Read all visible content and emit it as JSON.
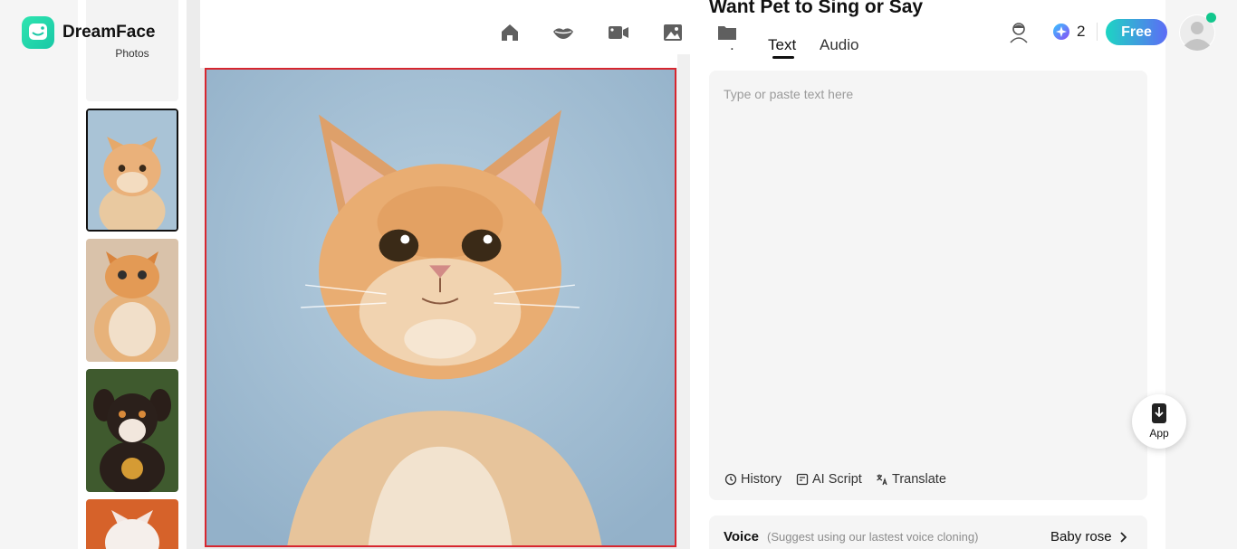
{
  "brand": {
    "name": "DreamFace"
  },
  "sidebar": {
    "photos_label": "Photos",
    "thumbnails": [
      {
        "name": "orange-cat-thumbnail",
        "selected": true
      },
      {
        "name": "chubby-cat-thumbnail",
        "selected": false
      },
      {
        "name": "puppy-thumbnail",
        "selected": false
      },
      {
        "name": "white-cat-thumbnail",
        "selected": false
      }
    ]
  },
  "nav": {
    "icons": [
      "home-icon",
      "lips-icon",
      "video-camera-icon",
      "image-icon",
      "folder-icon"
    ]
  },
  "panel": {
    "title": "Want Pet to Sing or Say",
    "tabs": [
      {
        "label": "Text",
        "active": true
      },
      {
        "label": "Audio",
        "active": false
      }
    ],
    "text_placeholder": "Type or paste text here",
    "tools": {
      "history": "History",
      "ai_script": "AI Script",
      "translate": "Translate"
    },
    "voice": {
      "label": "Voice",
      "hint": "(Suggest using our lastest voice cloning)",
      "value": "Baby rose"
    }
  },
  "header": {
    "credits": "2",
    "free_label": "Free"
  },
  "app_button": {
    "label": "App"
  },
  "colors": {
    "accent_gradient_start": "#1dd5c3",
    "accent_gradient_end": "#5d6bf6",
    "selection_border": "#d7262f",
    "online": "#12c78d"
  }
}
